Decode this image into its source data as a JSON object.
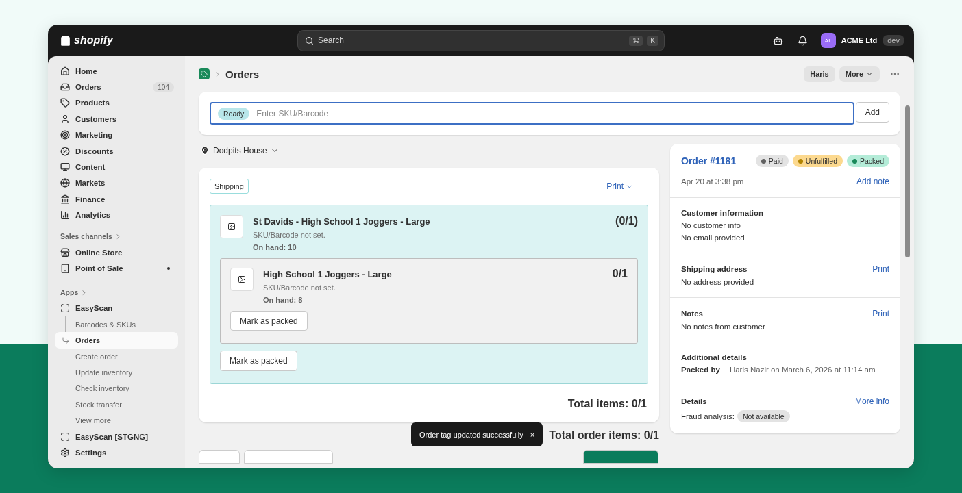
{
  "topbar": {
    "logo": "shopify",
    "search": {
      "placeholder": "Search",
      "keys": [
        "⌘",
        "K"
      ]
    },
    "avatar": "AL",
    "store": "ACME Ltd",
    "env_badge": "dev"
  },
  "sidebar": {
    "main": [
      {
        "label": "Home",
        "selected": false
      },
      {
        "label": "Orders",
        "badge": "104",
        "selected": false
      },
      {
        "label": "Products",
        "selected": false
      },
      {
        "label": "Customers",
        "selected": false
      },
      {
        "label": "Marketing",
        "selected": false
      },
      {
        "label": "Discounts",
        "selected": false
      },
      {
        "label": "Content",
        "selected": false
      },
      {
        "label": "Markets",
        "selected": false
      },
      {
        "label": "Finance",
        "selected": false
      },
      {
        "label": "Analytics",
        "selected": false
      }
    ],
    "sales_channels": {
      "heading": "Sales channels",
      "items": [
        {
          "label": "Online Store",
          "indicator": false
        },
        {
          "label": "Point of Sale",
          "indicator": true
        }
      ]
    },
    "apps": {
      "heading": "Apps",
      "items": [
        {
          "label": "EasyScan",
          "children": [
            {
              "label": "Barcodes & SKUs",
              "selected": false
            },
            {
              "label": "Orders",
              "selected": true
            },
            {
              "label": "Create order",
              "selected": false
            },
            {
              "label": "Update inventory",
              "selected": false
            },
            {
              "label": "Check inventory",
              "selected": false
            },
            {
              "label": "Stock transfer",
              "selected": false
            },
            {
              "label": "View more",
              "selected": false
            }
          ]
        },
        {
          "label": "EasyScan [STGNG]"
        }
      ]
    },
    "settings": "Settings"
  },
  "header": {
    "title": "Orders",
    "buttons": [
      "Haris",
      "More"
    ]
  },
  "scan": {
    "status": "Ready",
    "placeholder": "Enter SKU/Barcode",
    "button": "Add"
  },
  "location": "Dodpits House",
  "fulfillment": {
    "tag": "Shipping",
    "print": "Print",
    "bundle": {
      "title": "St Davids - High School 1 Joggers - Large",
      "count": "(0/1)",
      "sku": "SKU/Barcode not set.",
      "on_hand": "On hand: 10",
      "components": [
        {
          "title": "High School 1 Joggers - Large",
          "count": "0/1",
          "sku": "SKU/Barcode not set.",
          "on_hand": "On hand: 8",
          "button": "Mark as packed"
        }
      ],
      "button": "Mark as packed"
    },
    "total": "Total items: 0/1"
  },
  "total_order_items": "Total order items: 0/1",
  "toast": {
    "message": "Order tag updated successfully",
    "close": "×"
  },
  "order": {
    "title": "Order #1181",
    "badges": [
      {
        "label": "Paid",
        "color": "#e3e3e3"
      },
      {
        "label": "Unfulfilled",
        "color": "#fcd98f"
      },
      {
        "label": "Packed",
        "color": "#b4ecd8"
      }
    ],
    "date": "Apr 20 at 3:38 pm",
    "add_note": "Add note",
    "sections": [
      {
        "kind": "lines",
        "title": "Customer information",
        "lines": [
          "No customer info",
          "No email provided"
        ]
      },
      {
        "kind": "lines",
        "title": "Shipping address",
        "action": "Print",
        "lines": [
          "No address provided"
        ]
      },
      {
        "kind": "lines",
        "title": "Notes",
        "action": "Print",
        "lines": [
          "No notes from customer"
        ]
      },
      {
        "kind": "pair",
        "title": "Additional details",
        "label": "Packed by",
        "value": "Haris Nazir on March 6, 2026 at 11:14 am"
      },
      {
        "kind": "badge",
        "title": "Details",
        "action": "More info",
        "label": "Fraud analysis:",
        "badge": "Not available"
      }
    ]
  }
}
